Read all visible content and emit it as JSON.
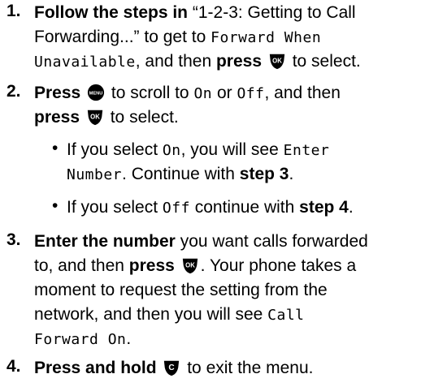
{
  "steps": [
    {
      "number": "1.",
      "bold_a": "Follow the steps in",
      "quote": " “1-2-3: Getting to Call",
      "quote2": "Forwarding...” to get to ",
      "mono_a": "Forward When",
      "mono_b": "Unavailable",
      "after_mono": ", and then ",
      "bold_b": "press",
      "tail": " to select."
    },
    {
      "number": "2.",
      "bold_a": "Press",
      "text_a": " to scroll to ",
      "mono_on": "On",
      "text_or": " or ",
      "mono_off": "Off",
      "text_b": ", and then",
      "bold_b": "press",
      "tail": " to select."
    },
    {
      "number": "3.",
      "bold_a": "Enter the number",
      "text_a": " you want calls forwarded",
      "text_b": "to, and then ",
      "bold_b": "press",
      "text_c": ". Your phone takes a",
      "text_d": "moment to request the setting from the",
      "text_e": "network, and then you will see ",
      "mono_a": "Call",
      "mono_b": "Forward On",
      "text_f": "."
    },
    {
      "number": "4.",
      "bold_a": "Press and hold",
      "tail": " to exit the menu."
    }
  ],
  "bullets": [
    {
      "dot": "•",
      "pre": "If you select ",
      "mono_a": "On",
      "mid": ", you will see ",
      "mono_b": "Enter",
      "mono_c": "Number",
      "post": ". Continue with ",
      "bold": "step 3",
      "end": "."
    },
    {
      "dot": "•",
      "pre": "If you select ",
      "mono_a": "Off",
      "post": " continue with ",
      "bold": "step 4",
      "end": "."
    }
  ],
  "icons": {
    "ok_key": "ok-key-icon",
    "menu_key": "menu-key-icon",
    "clear_key": "clear-key-icon",
    "ok_label": "OK",
    "menu_label": "MENU",
    "clear_label": "C"
  }
}
